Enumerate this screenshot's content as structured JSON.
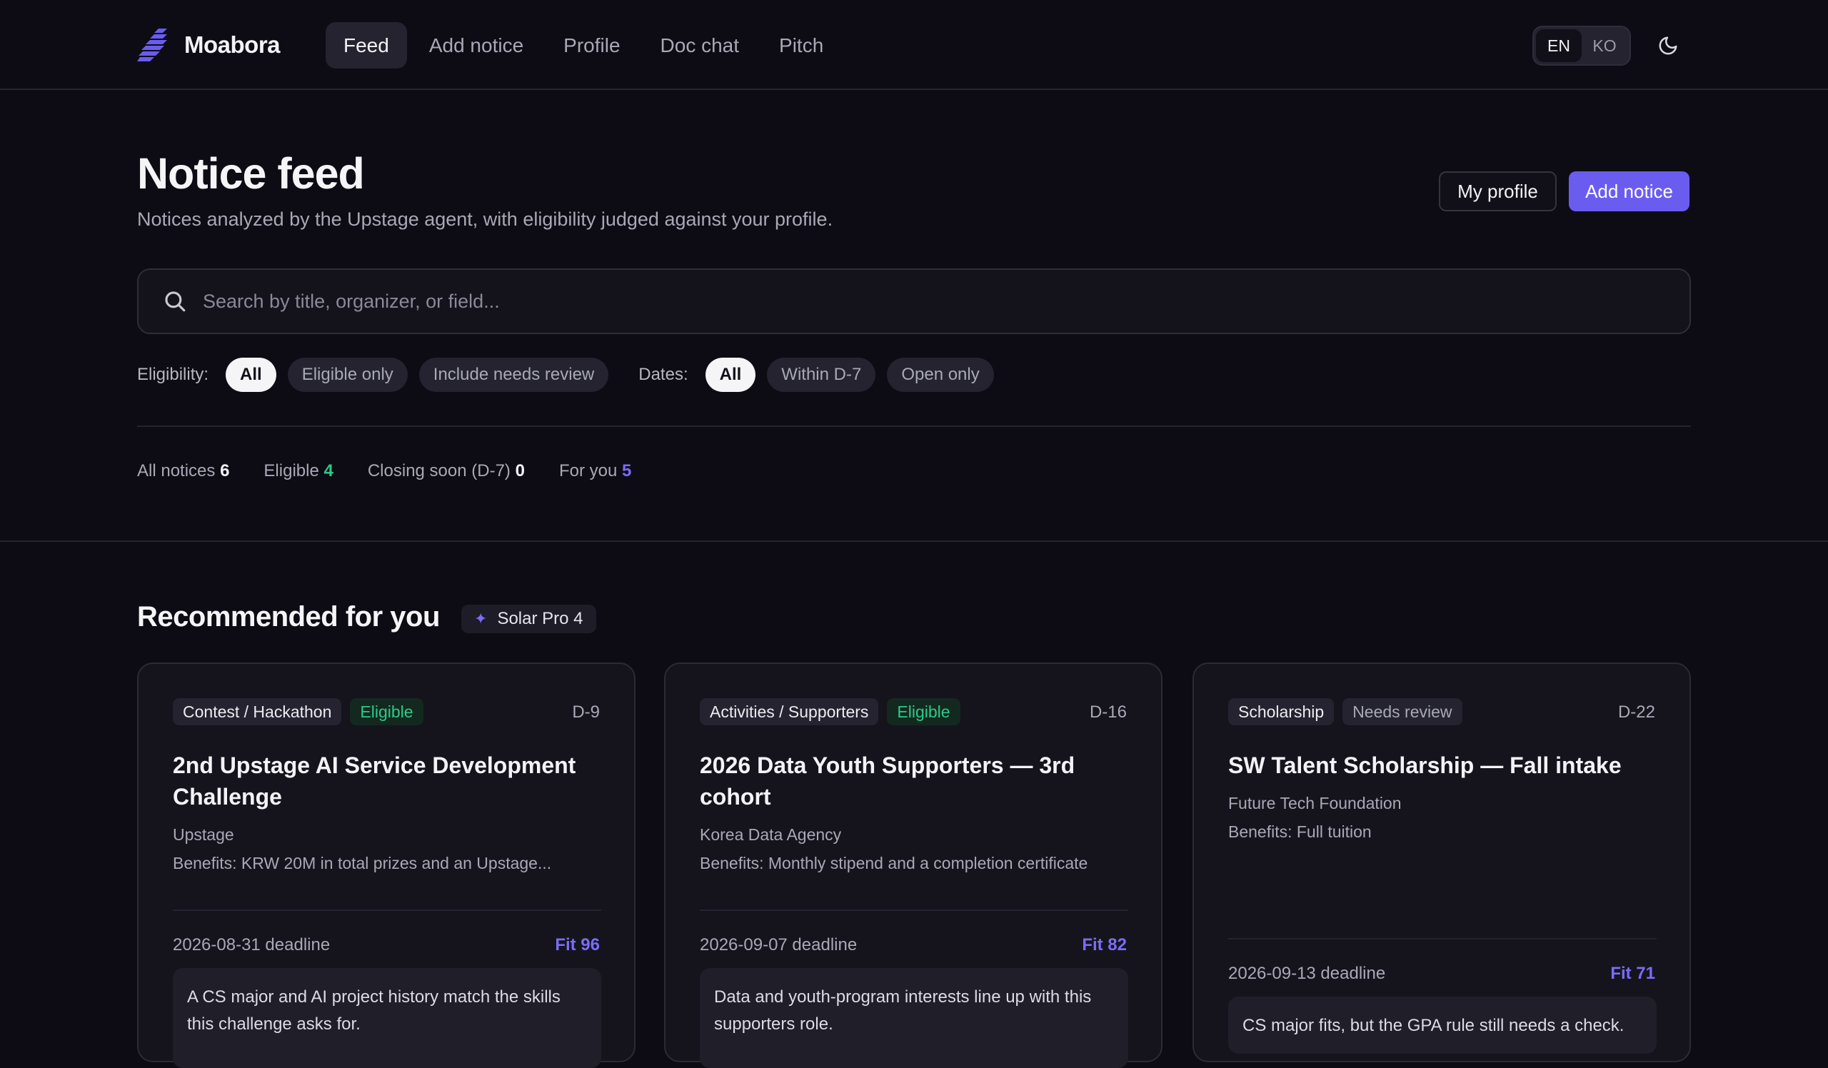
{
  "app": {
    "name": "Moabora"
  },
  "nav": [
    {
      "label": "Feed",
      "active": true
    },
    {
      "label": "Add notice"
    },
    {
      "label": "Profile"
    },
    {
      "label": "Doc chat"
    },
    {
      "label": "Pitch"
    }
  ],
  "lang": {
    "en": "EN",
    "ko": "KO",
    "selected": "EN"
  },
  "theme": {
    "icon": "moon-icon"
  },
  "header": {
    "title": "Notice feed",
    "subtitle": "Notices analyzed by the Upstage agent, with eligibility judged against your profile.",
    "my_profile": "My profile",
    "add_notice": "Add notice"
  },
  "search": {
    "placeholder": "Search by title, organizer, or field...",
    "icon": "search-icon"
  },
  "filters": {
    "eligibility_label": "Eligibility:",
    "eligibility": [
      "All",
      "Eligible only",
      "Include needs review"
    ],
    "dates_label": "Dates:",
    "dates": [
      "All",
      "Within D-7",
      "Open only"
    ]
  },
  "stats": {
    "all_label": "All notices",
    "all_value": "6",
    "eligible_label": "Eligible",
    "eligible_value": "4",
    "closing_label": "Closing soon (D-7)",
    "closing_value": "0",
    "foryou_label": "For you",
    "foryou_value": "5"
  },
  "recommended": {
    "title": "Recommended for you",
    "model_badge": "Solar Pro 4",
    "cards": [
      {
        "category": "Contest / Hackathon",
        "status": "Eligible",
        "dday": "D-9",
        "title": "2nd Upstage AI Service Development Challenge",
        "org": "Upstage",
        "benefits": "Benefits: KRW 20M in total prizes and an Upstage...",
        "deadline": "2026-08-31 deadline",
        "fit": "Fit 96",
        "reason": "A CS major and AI project history match the skills this challenge asks for."
      },
      {
        "category": "Activities / Supporters",
        "status": "Eligible",
        "dday": "D-16",
        "title": "2026 Data Youth Supporters — 3rd cohort",
        "org": "Korea Data Agency",
        "benefits": "Benefits: Monthly stipend and a completion certificate",
        "deadline": "2026-09-07 deadline",
        "fit": "Fit 82",
        "reason": "Data and youth-program interests line up with this supporters role."
      },
      {
        "category": "Scholarship",
        "status": "Needs review",
        "dday": "D-22",
        "title": "SW Talent Scholarship — Fall intake",
        "org": "Future Tech Foundation",
        "benefits": "Benefits: Full tuition",
        "deadline": "2026-09-13 deadline",
        "fit": "Fit 71",
        "reason": "CS major fits, but the GPA rule still needs a check."
      }
    ]
  }
}
